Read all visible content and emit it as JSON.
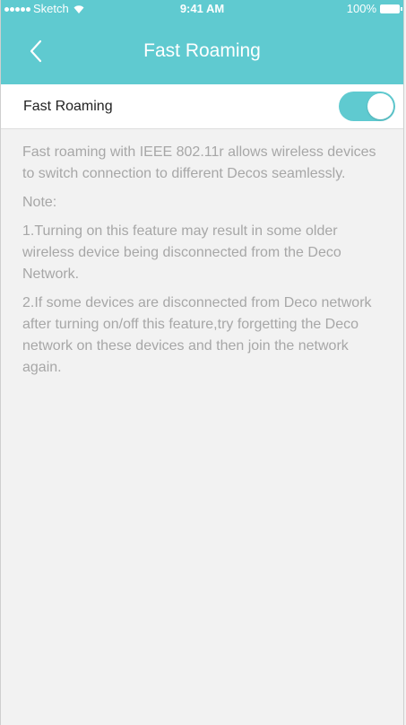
{
  "status_bar": {
    "carrier": "Sketch",
    "time": "9:41 AM",
    "battery": "100%"
  },
  "nav": {
    "title": "Fast Roaming",
    "back_icon": "chevron-left-icon"
  },
  "setting": {
    "label": "Fast Roaming",
    "enabled": true,
    "toggle_color": "#5fcad0"
  },
  "description": {
    "intro": "Fast roaming with IEEE 802.11r allows wireless devices to switch connection to different Decos seamlessly.",
    "note_heading": "Note:",
    "note_1": "1.Turning on this feature may result in some older wireless device being disconnected  from the Deco Network.",
    "note_2": "2.If some devices are disconnected from Deco network after turning on/off this feature,try forgetting the Deco network on these devices and then join the network again."
  },
  "colors": {
    "accent": "#5fcad0",
    "background": "#f2f2f2",
    "description_text": "#a7a7a7"
  }
}
